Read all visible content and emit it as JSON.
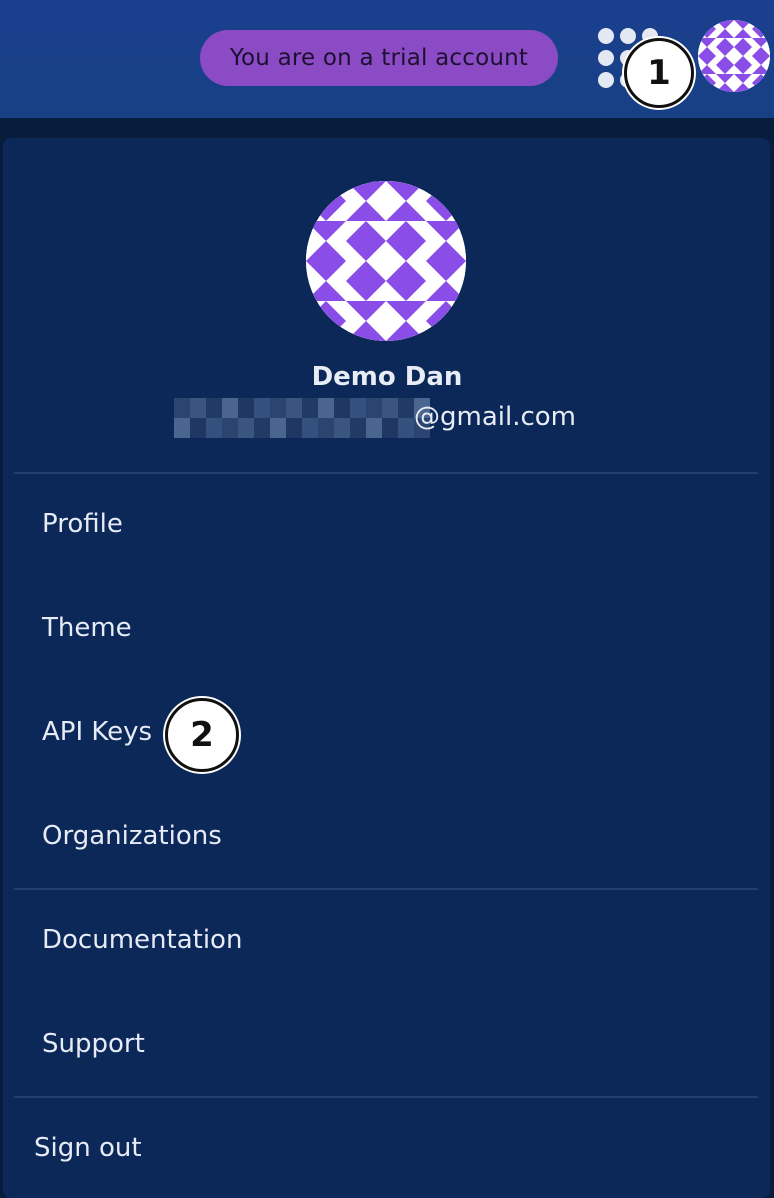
{
  "header": {
    "trial_badge": "You are on a trial account",
    "apps_icon": "grid-dots-icon",
    "avatar_icon": "identicon-avatar",
    "step_marker": "1"
  },
  "colors": {
    "header_bg": "#1b3f8e",
    "panel_bg": "#0b2858",
    "badge_bg": "#8a4bc4",
    "identicon": "#8b4de8"
  },
  "user": {
    "name": "Demo Dan",
    "email_visible": "@gmail.com",
    "email_redacted": true
  },
  "menu": {
    "group1": [
      {
        "label": "Profile"
      },
      {
        "label": "Theme"
      },
      {
        "label": "API Keys",
        "step_marker": "2"
      },
      {
        "label": "Organizations"
      }
    ],
    "group2": [
      {
        "label": "Documentation"
      },
      {
        "label": "Support"
      }
    ],
    "signout": "Sign out"
  }
}
